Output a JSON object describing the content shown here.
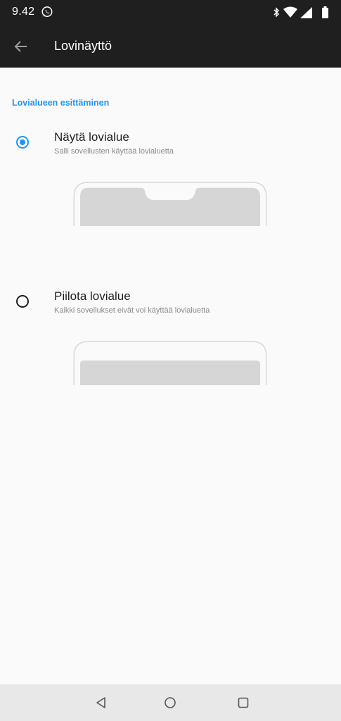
{
  "status_bar": {
    "time": "9.42",
    "icons": [
      "whatsapp-icon",
      "bluetooth-icon",
      "wifi-icon",
      "signal-icon",
      "battery-icon"
    ]
  },
  "app_bar": {
    "title": "Lovinäyttö",
    "back_icon": "arrow-back-icon"
  },
  "section": {
    "header": "Lovialueen esittäminen"
  },
  "options": [
    {
      "title": "Näytä lovialue",
      "subtitle": "Salli sovellusten käyttää lovialuetta",
      "selected": true
    },
    {
      "title": "Piilota lovialue",
      "subtitle": "Kaikki sovellukset eivät voi käyttää lovialuetta",
      "selected": false
    }
  ],
  "nav_bar": {
    "icons": [
      "back-triangle-icon",
      "home-circle-icon",
      "recents-square-icon"
    ]
  },
  "colors": {
    "accent": "#2196f3",
    "bar_dark": "#1f1f1f",
    "background": "#fafafa",
    "nav_bg": "#e8e8e8"
  }
}
